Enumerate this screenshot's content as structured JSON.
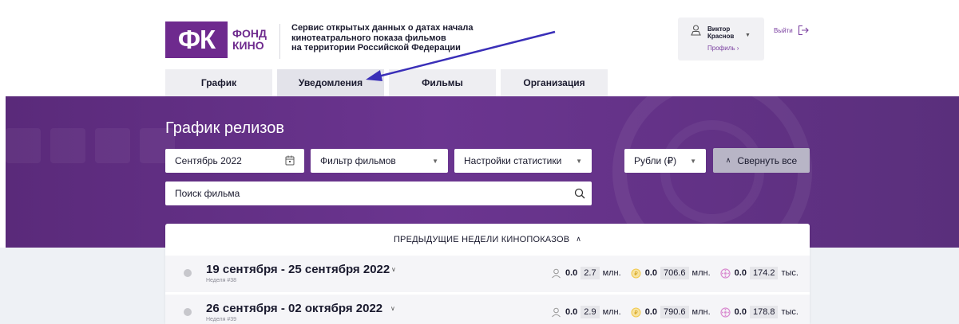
{
  "header": {
    "logo": {
      "badge": "ФК",
      "word1": "ФОНД",
      "word2": "КИНО"
    },
    "tagline": [
      "Сервис открытых данных о датах начала",
      "кинотеатрального показа фильмов",
      "на территории Российской Федерации"
    ],
    "user": {
      "first_name": "Виктор",
      "last_name": "Краснов",
      "profile_link": "Профиль ›"
    },
    "logout_label": "Выйти"
  },
  "tabs": [
    {
      "label": "График"
    },
    {
      "label": "Уведомления"
    },
    {
      "label": "Фильмы"
    },
    {
      "label": "Организация"
    }
  ],
  "hero": {
    "title": "График релизов",
    "month_value": "Сентябрь 2022",
    "filter_label": "Фильтр фильмов",
    "stats_settings_label": "Настройки статистики",
    "currency_label": "Рубли (₽)",
    "collapse_label": "Свернуть все",
    "search_placeholder": "Поиск фильма"
  },
  "panel": {
    "prev_weeks_label": "ПРЕДЫДУЩИЕ НЕДЕЛИ КИНОПОКАЗОВ",
    "weeks": [
      {
        "title": "19 сентября - 25 сентября 2022",
        "number": "Неделя #38",
        "viewers": {
          "bold": "0.0",
          "value": "2.7",
          "unit": "млн."
        },
        "money": {
          "bold": "0.0",
          "value": "706.6",
          "unit": "млн."
        },
        "sessions": {
          "bold": "0.0",
          "value": "174.2",
          "unit": "тыс."
        }
      },
      {
        "title": "26 сентября - 02 октября 2022",
        "number": "Неделя #39",
        "viewers": {
          "bold": "0.0",
          "value": "2.9",
          "unit": "млн."
        },
        "money": {
          "bold": "0.0",
          "value": "790.6",
          "unit": "млн."
        },
        "sessions": {
          "bold": "0.0",
          "value": "178.8",
          "unit": "тыс."
        }
      }
    ]
  },
  "colors": {
    "brand_purple": "#6e2a8e",
    "hero_purple": "#6b3590",
    "link_purple": "#7a3fa0",
    "annotation_arrow": "#3a2fb8",
    "coin_yellow": "#f2c94c",
    "sessions_pink": "#d98bd0"
  },
  "icons": [
    "user-icon",
    "logout-icon",
    "calendar-icon",
    "search-icon",
    "chevron-down-icon",
    "chevron-up-icon",
    "viewers-icon",
    "coin-icon",
    "sessions-icon"
  ]
}
